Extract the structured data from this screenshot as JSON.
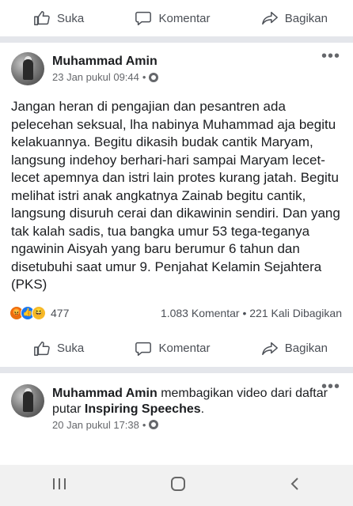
{
  "actions": {
    "like": "Suka",
    "comment": "Komentar",
    "share": "Bagikan"
  },
  "post1": {
    "author": "Muhammad Amin",
    "time": "23 Jan pukul 09:44",
    "privacy_dot": "•",
    "text": "Jangan heran di pengajian dan pesantren ada pelecehan seksual, lha nabinya Muhammad aja begitu kelakuannya. Begitu dikasih budak cantik Maryam, langsung indehoy berhari-hari sampai Maryam lecet-lecet apemnya dan istri lain protes kurang jatah. Begitu melihat istri anak angkatnya Zainab begitu cantik, langsung disuruh cerai dan dikawinin sendiri. Dan yang tak kalah sadis, tua bangka umur 53 tega-teganya ngawinin Aisyah yang baru berumur 6 tahun dan disetubuhi saat umur 9. Penjahat Kelamin Sejahtera (PKS)",
    "reactions_count": "477",
    "comments": "1.083 Komentar",
    "stat_dot": "•",
    "shares": "221 Kali Dibagikan"
  },
  "post2": {
    "author": "Muhammad Amin",
    "action_text": " membagikan video dari daftar putar ",
    "playlist": "Inspiring Speeches",
    "period": ".",
    "time": "20 Jan pukul 17:38",
    "privacy_dot": "•"
  },
  "icons": [
    "thumbs-up-icon",
    "comment-icon",
    "share-icon",
    "globe-icon",
    "more-icon",
    "angry-reaction-icon",
    "like-reaction-icon",
    "haha-reaction-icon",
    "recents-icon",
    "home-icon",
    "back-icon"
  ]
}
